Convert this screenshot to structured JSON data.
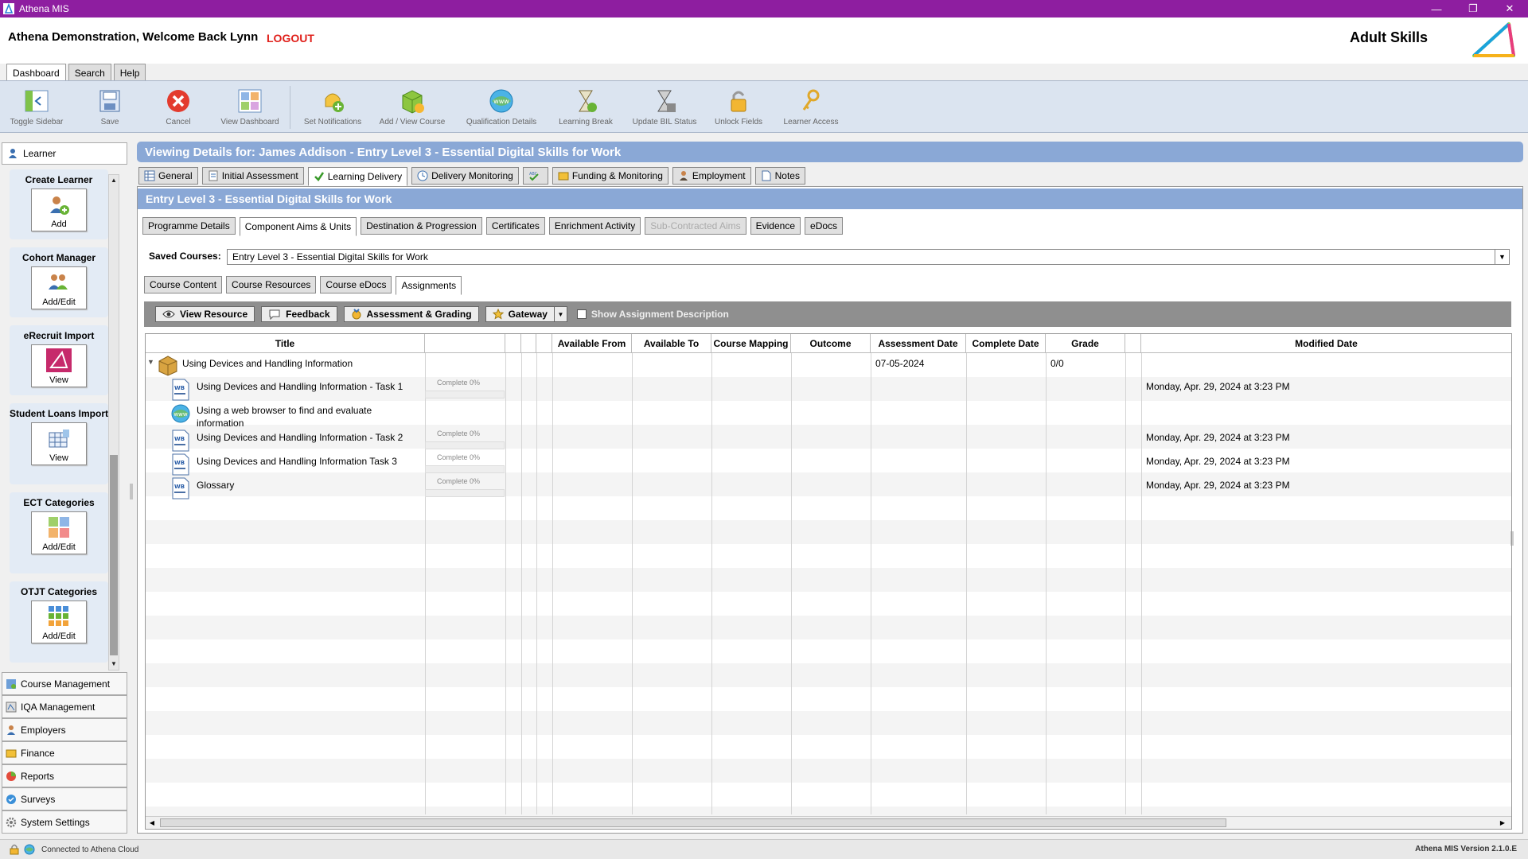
{
  "window": {
    "title": "Athena MIS",
    "minimize": "—",
    "restore": "❐",
    "close": "✕"
  },
  "header": {
    "welcome": "Athena Demonstration,  Welcome Back Lynn",
    "logout": "LOGOUT",
    "product": "Adult Skills"
  },
  "top_tabs": [
    {
      "label": "Dashboard",
      "active": true
    },
    {
      "label": "Search"
    },
    {
      "label": "Help"
    }
  ],
  "toolbar": [
    {
      "label": "Toggle Sidebar",
      "icon": "toggle-sidebar-icon"
    },
    {
      "label": "Save",
      "icon": "save-icon"
    },
    {
      "label": "Cancel",
      "icon": "cancel-icon"
    },
    {
      "label": "View Dashboard",
      "icon": "dashboard-icon"
    },
    {
      "label": "Set Notifications",
      "icon": "notifications-icon"
    },
    {
      "label": "Add / View Course",
      "icon": "course-icon"
    },
    {
      "label": "Qualification Details",
      "icon": "qualification-globe-icon"
    },
    {
      "label": "Learning Break",
      "icon": "hourglass-icon"
    },
    {
      "label": "Update BIL Status",
      "icon": "bil-status-icon"
    },
    {
      "label": "Unlock Fields",
      "icon": "padlock-icon"
    },
    {
      "label": "Learner Access",
      "icon": "keys-icon"
    }
  ],
  "sidebar": {
    "header": "Learner",
    "cards": [
      {
        "title": "Create Learner",
        "button": "Add",
        "icon": "add-learner-icon"
      },
      {
        "title": "Cohort Manager",
        "button": "Add/Edit",
        "icon": "cohort-icon"
      },
      {
        "title": "eRecruit Import",
        "button": "View",
        "icon": "erecruit-icon"
      },
      {
        "title": "Student Loans Import",
        "button": "View",
        "icon": "student-loans-icon"
      },
      {
        "title": "ECT Categories",
        "button": "Add/Edit",
        "icon": "ect-categories-icon"
      },
      {
        "title": "OTJT Categories",
        "button": "Add/Edit",
        "icon": "otjt-categories-icon"
      }
    ],
    "nav": [
      {
        "label": "Course Management",
        "icon": "course-management-icon"
      },
      {
        "label": "IQA Management",
        "icon": "iqa-icon"
      },
      {
        "label": "Employers",
        "icon": "employers-icon"
      },
      {
        "label": "Finance",
        "icon": "finance-icon"
      },
      {
        "label": "Reports",
        "icon": "reports-icon"
      },
      {
        "label": "Surveys",
        "icon": "surveys-icon"
      },
      {
        "label": "System Settings",
        "icon": "settings-gear-icon"
      }
    ]
  },
  "main": {
    "viewing": "Viewing Details for: James Addison - Entry Level 3 - Essential Digital Skills for Work",
    "learner_tabs": [
      {
        "label": "General"
      },
      {
        "label": "Initial Assessment"
      },
      {
        "label": "Learning Delivery",
        "active": true
      },
      {
        "label": "Delivery Monitoring"
      },
      {
        "label": ""
      },
      {
        "label": "Funding & Monitoring"
      },
      {
        "label": "Employment"
      },
      {
        "label": "Notes"
      }
    ],
    "course_title": "Entry Level 3 - Essential Digital Skills for Work",
    "course_tabs": [
      {
        "label": "Programme Details"
      },
      {
        "label": "Component Aims & Units",
        "active": true
      },
      {
        "label": "Destination & Progression"
      },
      {
        "label": "Certificates"
      },
      {
        "label": "Enrichment Activity"
      },
      {
        "label": "Sub-Contracted Aims",
        "disabled": true
      },
      {
        "label": "Evidence"
      },
      {
        "label": "eDocs"
      }
    ],
    "saved_courses_label": "Saved Courses:",
    "saved_courses_value": "Entry Level 3 - Essential Digital Skills for Work",
    "sub_tabs": [
      {
        "label": "Course Content"
      },
      {
        "label": "Course Resources"
      },
      {
        "label": "Course eDocs"
      },
      {
        "label": "Assignments",
        "active": true
      }
    ],
    "actions": {
      "view_resource": "View Resource",
      "feedback": "Feedback",
      "assessment": "Assessment & Grading",
      "gateway": "Gateway",
      "show_desc": "Show Assignment Description"
    },
    "columns": [
      "Title",
      "",
      "",
      "",
      "",
      "Available From",
      "Available To",
      "Course Mapping",
      "Outcome",
      "Assessment Date",
      "Complete Date",
      "Grade",
      "",
      "Modified Date"
    ],
    "rows": [
      {
        "title": "Using Devices and Handling Information",
        "parent": true,
        "assessment_date": "07-05-2024",
        "grade": "0/0",
        "modified": "",
        "complete": ""
      },
      {
        "title": "Using Devices and Handling Information - Task 1",
        "complete": "Complete 0%",
        "progress": 0,
        "modified": "Monday, Apr. 29, 2024 at 3:23 PM"
      },
      {
        "title": "Using a web browser to find and evaluate information",
        "complete": "",
        "modified": "",
        "web": true
      },
      {
        "title": "Using Devices and Handling Information - Task 2",
        "complete": "Complete 0%",
        "progress": 0,
        "modified": "Monday, Apr. 29, 2024 at 3:23 PM"
      },
      {
        "title": "Using Devices and Handling Information Task 3",
        "complete": "Complete 0%",
        "progress": 0,
        "modified": "Monday, Apr. 29, 2024 at 3:23 PM"
      },
      {
        "title": "Glossary",
        "complete": "Complete 0%",
        "progress": 0,
        "modified": "Monday, Apr. 29, 2024 at 3:23 PM"
      }
    ]
  },
  "status": {
    "connection": "Connected to Athena Cloud",
    "version": "Athena MIS Version 2.1.0.E"
  },
  "colors": {
    "titlebar": "#8e1ea0",
    "accent_blue": "#8aa8d6",
    "logout": "#e0201b",
    "toolbar_bg": "#dbe4f0"
  }
}
